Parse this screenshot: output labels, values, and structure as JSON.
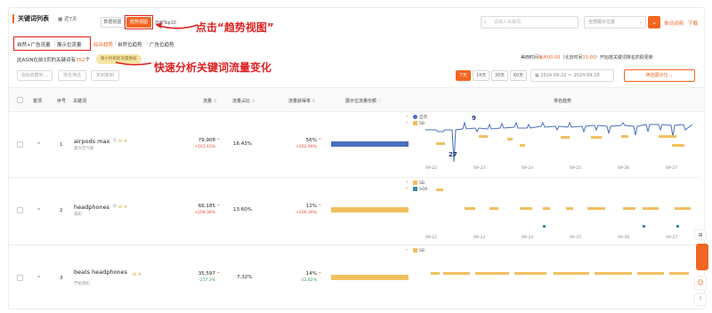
{
  "header": {
    "title": "关键词列表",
    "date_range": "近7天",
    "view_data": "数据视图",
    "view_trend": "趋势视图",
    "view_top10": "自然Top10",
    "search_placeholder": "请输入关键词",
    "position_placeholder": "全部展示位置",
    "single_trend": "单词词频",
    "download": "下载"
  },
  "annotations": {
    "click_hint": "点击“趋势视图”",
    "analyze_hint": "快速分析关键词流量变化"
  },
  "tabs": [
    "自然+广告流量",
    "展示位流量",
    "综合趋势",
    "自然位趋势",
    "广告位趋势"
  ],
  "summary": {
    "prefix": "此ASIN在前3页的关键词有",
    "count": "752",
    "suffix": "个",
    "badge": "每小时刷新流量数据",
    "time_label_a": "美西时间",
    "time_val_a": "每天00:00",
    "time_label_b": "（北京时间",
    "time_val_b": "15:00",
    "time_label_c": "）开始按关键词排名抓取更新"
  },
  "toolbar": {
    "add_group": "添加收藏到",
    "rank_filter": "排名筛选",
    "copy_words": "复制复制",
    "range_buttons": [
      "7天",
      "14天",
      "30天",
      "60天"
    ],
    "date_from": "2024-09-22",
    "date_sep": "～",
    "date_to": "2024-09-28",
    "filter_btn": "筛选展示位"
  },
  "columns": [
    "置顶",
    "序号",
    "关键词",
    "流量",
    "流量占比",
    "流量获得率",
    "展示位流量份额",
    "排名趋势"
  ],
  "rows": [
    {
      "index": "1",
      "keyword": "airpods max",
      "translation": "最大空气舱",
      "traffic": "79,908",
      "traffic_change": "+163.43%",
      "share": "16.43%",
      "rate": "56%",
      "rate_change": "+162.99%",
      "bar_color": "#4a6fbf",
      "legend": [
        "自然",
        "SB"
      ],
      "peak_label": "9",
      "low_label": "27"
    },
    {
      "index": "2",
      "keyword": "headphones",
      "translation": "耳机",
      "traffic": "66,185",
      "traffic_change": "+209.38%",
      "share": "13.60%",
      "rate": "12%",
      "rate_change": "+236.39%",
      "bar_color": "#f0c060",
      "legend": [
        "SB",
        "SOR"
      ]
    },
    {
      "index": "3",
      "keyword": "beats headphones",
      "translation": "节拍耳机",
      "traffic": "35,597",
      "traffic_change": "-217.3%",
      "share": "7.32%",
      "rate": "14%",
      "rate_change": "-22.82%",
      "bar_color": "#f0c060",
      "legend": [
        "SB"
      ]
    }
  ],
  "x_labels": [
    "09-22",
    "09-23",
    "09-24",
    "09-25",
    "09-26",
    "09-27"
  ],
  "colors": {
    "accent": "#f26522",
    "natural": "#4a6fbf",
    "sb": "#f0c060",
    "sor": "#3a8ca0",
    "up": "#e84c3d",
    "down": "#2e9e57"
  }
}
